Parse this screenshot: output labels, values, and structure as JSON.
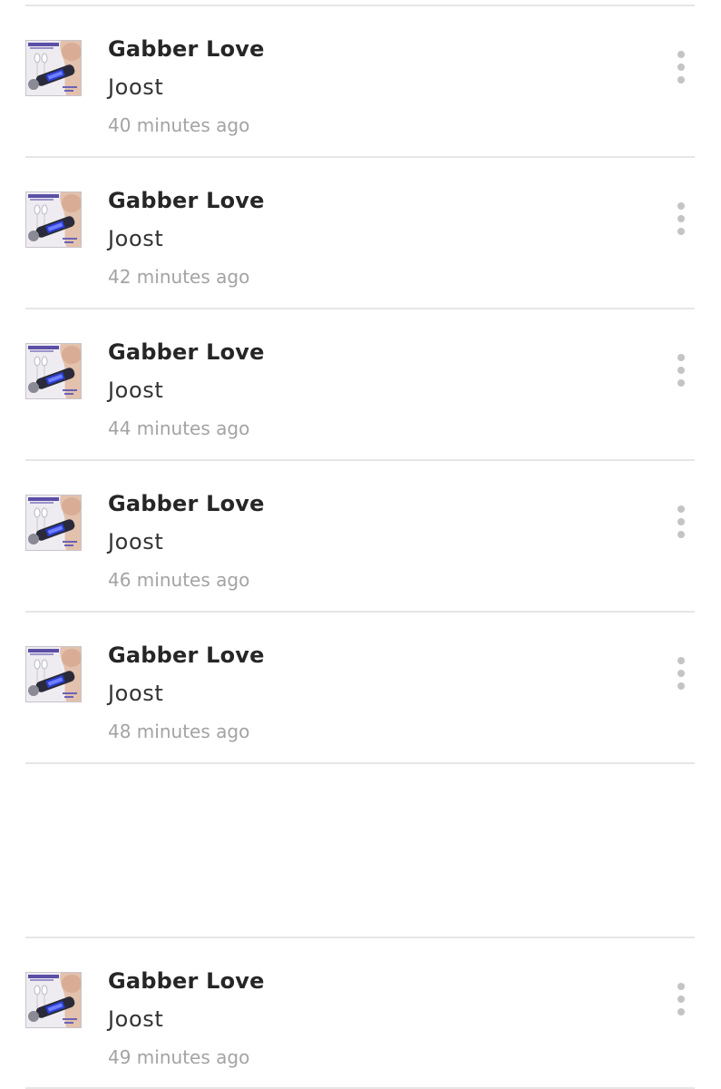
{
  "tracks": [
    {
      "title": "Gabber Love",
      "artist": "Joost",
      "time_ago": "40 minutes ago",
      "thumbnail_icon": "album-art-thumbnail",
      "menu_icon": "more-vertical-icon"
    },
    {
      "title": "Gabber Love",
      "artist": "Joost",
      "time_ago": "42 minutes ago",
      "thumbnail_icon": "album-art-thumbnail",
      "menu_icon": "more-vertical-icon"
    },
    {
      "title": "Gabber Love",
      "artist": "Joost",
      "time_ago": "44 minutes ago",
      "thumbnail_icon": "album-art-thumbnail",
      "menu_icon": "more-vertical-icon"
    },
    {
      "title": "Gabber Love",
      "artist": "Joost",
      "time_ago": "46 minutes ago",
      "thumbnail_icon": "album-art-thumbnail",
      "menu_icon": "more-vertical-icon"
    },
    {
      "title": "Gabber Love",
      "artist": "Joost",
      "time_ago": "48 minutes ago",
      "thumbnail_icon": "album-art-thumbnail",
      "menu_icon": "more-vertical-icon"
    },
    {
      "title": "Gabber Love",
      "artist": "Joost",
      "time_ago": "49 minutes ago",
      "thumbnail_icon": "album-art-thumbnail",
      "menu_icon": "more-vertical-icon"
    }
  ],
  "colors": {
    "title": "#262626",
    "artist": "#333333",
    "time": "#a3a3a3",
    "divider": "#e6e6e6",
    "menu_dots": "#c4c4c4"
  }
}
